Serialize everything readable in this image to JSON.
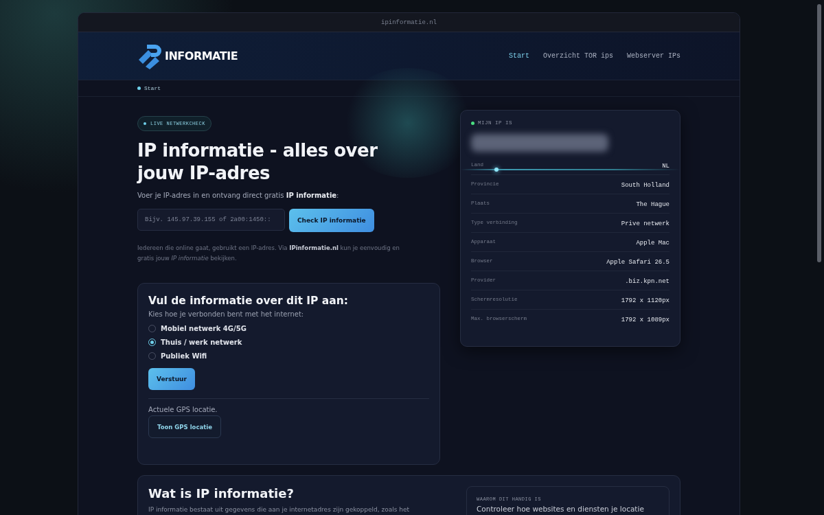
{
  "address_bar": {
    "url": "ipinformatie.nl"
  },
  "header": {
    "logo_text": "INFORMATIE",
    "nav": [
      {
        "label": "Start",
        "selected": true
      },
      {
        "label": "Overzicht TOR ips",
        "selected": false
      },
      {
        "label": "Webserver IPs",
        "selected": false
      }
    ]
  },
  "breadcrumb": [
    "Start"
  ],
  "hero": {
    "badge": "LIVE NETWERKCHECK",
    "title": "IP informatie - alles over jouw IP-adres",
    "subtitle": "Voer je IP-adres in en ontvang direct gratis **IP informatie**:",
    "search": {
      "placeholder": "Bijv. 145.97.39.155 of 2a00:1450::"
    },
    "button": "Check IP informatie",
    "note": "Iedereen die online gaat, gebruikt een IP-adres. Via **IPinformatie.nl** kun je eenvoudig en gratis jouw *IP informatie* bekijken."
  },
  "form": {
    "title": "Vul de informatie over dit IP aan:",
    "prompt": "Kies hoe je verbonden bent met het internet:",
    "options": [
      {
        "label": "Mobiel netwerk 4G/5G",
        "selected": false
      },
      {
        "label": "Thuis / werk netwerk",
        "selected": true
      },
      {
        "label": "Publiek Wifi",
        "selected": false
      }
    ],
    "submit": "Verstuur",
    "gps_label": "Actuele GPS locatie.",
    "gps_button": "Toon GPS locatie"
  },
  "ip_card": {
    "label": "MIJN IP IS",
    "rows": [
      {
        "key": "Land",
        "value": "NL"
      },
      {
        "key": "Provincie",
        "value": "South Holland"
      },
      {
        "key": "Plaats",
        "value": "The Hague"
      },
      {
        "key": "Type verbinding",
        "value": "Prive netwerk"
      },
      {
        "key": "Apparaat",
        "value": "Apple Mac"
      },
      {
        "key": "Browser",
        "value": "Apple Safari 26.5"
      },
      {
        "key": "Provider",
        "value": ".biz.kpn.net"
      },
      {
        "key": "Schermresolutie",
        "value": "1792 x 1120px"
      },
      {
        "key": "Max. browserscherm",
        "value": "1792 x 1089px"
      }
    ]
  },
  "about": {
    "title": "Wat is IP informatie?",
    "text": "IP informatie bestaat uit gegevens die aan je internetadres zijn gekoppeld, zoals het",
    "side_label": "WAAROM DIT HANDIG IS",
    "side_text": "Controleer hoe websites en diensten je locatie"
  }
}
